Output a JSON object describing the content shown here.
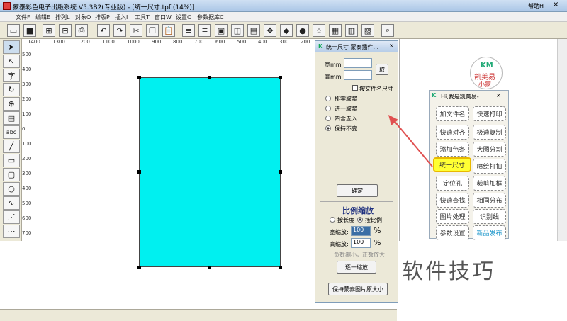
{
  "window": {
    "title": "蒙泰彩色电子出版系统 V5.3B2(专业版) - [统一尺寸.tpf (14%)]",
    "help": "帮助H",
    "controls": [
      "–",
      "□",
      "×"
    ]
  },
  "menu": [
    "文件F",
    "编辑E",
    "排列L",
    "对象O",
    "排版P",
    "插入I",
    "工具T",
    "窗口W",
    "设置O",
    "参数据库C"
  ],
  "ruler_h": [
    "1400",
    "1300",
    "1200",
    "1100",
    "1000",
    "900",
    "800",
    "700",
    "600",
    "500",
    "400",
    "300",
    "200",
    "100",
    "0",
    "100"
  ],
  "ruler_v": [
    "500",
    "400",
    "300",
    "200",
    "100",
    "0",
    "100",
    "200",
    "300",
    "400",
    "500",
    "600",
    "700"
  ],
  "left_tools_text": {
    "text_tool": "字",
    "abc": "abc"
  },
  "dialog": {
    "title": "统一尺寸 蒙泰插件...",
    "width_label": "宽mm",
    "height_label": "高mm",
    "fetch_button": "取",
    "checkbox_label": "按文件名尺寸",
    "radio_options": [
      "排零取整",
      "进一取整",
      "四舍五入",
      "保持不变"
    ],
    "selected_radio": "保持不变",
    "ok_button": "确定",
    "section_title": "比例缩放",
    "mode_options": [
      "按长度",
      "按比例"
    ],
    "selected_mode": "按比例",
    "width_scale_label": "宽缩放:",
    "width_scale_value": "100",
    "height_scale_label": "高缩放:",
    "height_scale_value": "100",
    "percent": "%",
    "hint": "负数缩小，正数放大",
    "scale_button": "逐一缩放",
    "keep_button": "保持蒙泰图片原大小"
  },
  "plugin_panel": {
    "title": "Hi,我是凯美易-...",
    "buttons": [
      "加文件名",
      "快速打印",
      "快速对齐",
      "极速复制",
      "添加色条",
      "大图分割",
      "统一尺寸",
      "喷绘打扣",
      "定位孔",
      "裁剪加框",
      "快速查找",
      "相同分布",
      "图片处理",
      "识别线",
      "参数设置",
      "新品发布"
    ],
    "highlighted": "统一尺寸"
  },
  "logo": {
    "top": "KM",
    "line1": "凯美易",
    "line2": "小蒙"
  },
  "watermark": "软件技巧",
  "colors": {
    "cyan": "#00f0f0",
    "highlight": "#ffff33",
    "arrow": "#e05050"
  }
}
